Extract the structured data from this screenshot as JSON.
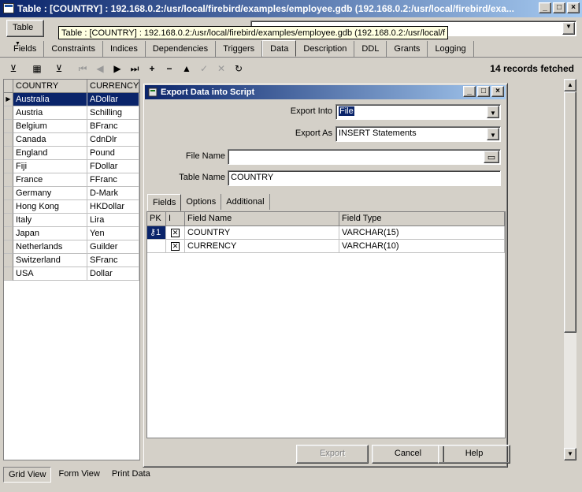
{
  "window": {
    "title": "Table : [COUNTRY] : 192.168.0.2:/usr/local/firebird/examples/employee.gdb (192.168.0.2:/usr/local/firebird/exa...",
    "tooltip": "Table : [COUNTRY] : 192.168.0.2:/usr/local/firebird/examples/employee.gdb (192.168.0.2:/usr/local/f"
  },
  "toolbar": {
    "table_button": "Table"
  },
  "tabs": [
    "Fields",
    "Constraints",
    "Indices",
    "Dependencies",
    "Triggers",
    "Data",
    "Description",
    "DDL",
    "Grants",
    "Logging"
  ],
  "active_tab": "Data",
  "records_text": "14 records fetched",
  "grid": {
    "columns": [
      "COUNTRY",
      "CURRENCY"
    ],
    "rows": [
      [
        "Australia",
        "ADollar"
      ],
      [
        "Austria",
        "Schilling"
      ],
      [
        "Belgium",
        "BFranc"
      ],
      [
        "Canada",
        "CdnDlr"
      ],
      [
        "England",
        "Pound"
      ],
      [
        "Fiji",
        "FDollar"
      ],
      [
        "France",
        "FFranc"
      ],
      [
        "Germany",
        "D-Mark"
      ],
      [
        "Hong Kong",
        "HKDollar"
      ],
      [
        "Italy",
        "Lira"
      ],
      [
        "Japan",
        "Yen"
      ],
      [
        "Netherlands",
        "Guilder"
      ],
      [
        "Switzerland",
        "SFranc"
      ],
      [
        "USA",
        "Dollar"
      ]
    ]
  },
  "view_tabs": [
    "Grid View",
    "Form View",
    "Print Data"
  ],
  "dialog": {
    "title": "Export Data into Script",
    "export_into_label": "Export Into",
    "export_into_value": "File",
    "export_as_label": "Export As",
    "export_as_value": "INSERT Statements",
    "file_name_label": "File Name",
    "file_name_value": "",
    "table_name_label": "Table Name",
    "table_name_value": "COUNTRY",
    "tabs": [
      "Fields",
      "Options",
      "Additional"
    ],
    "field_columns": [
      "PK",
      "I",
      "Field Name",
      "Field Type"
    ],
    "fields": [
      {
        "name": "COUNTRY",
        "type": "VARCHAR(15)",
        "checked": true,
        "pk": true
      },
      {
        "name": "CURRENCY",
        "type": "VARCHAR(10)",
        "checked": true,
        "pk": false
      }
    ],
    "buttons": {
      "export": "Export",
      "cancel": "Cancel",
      "help": "Help"
    }
  }
}
